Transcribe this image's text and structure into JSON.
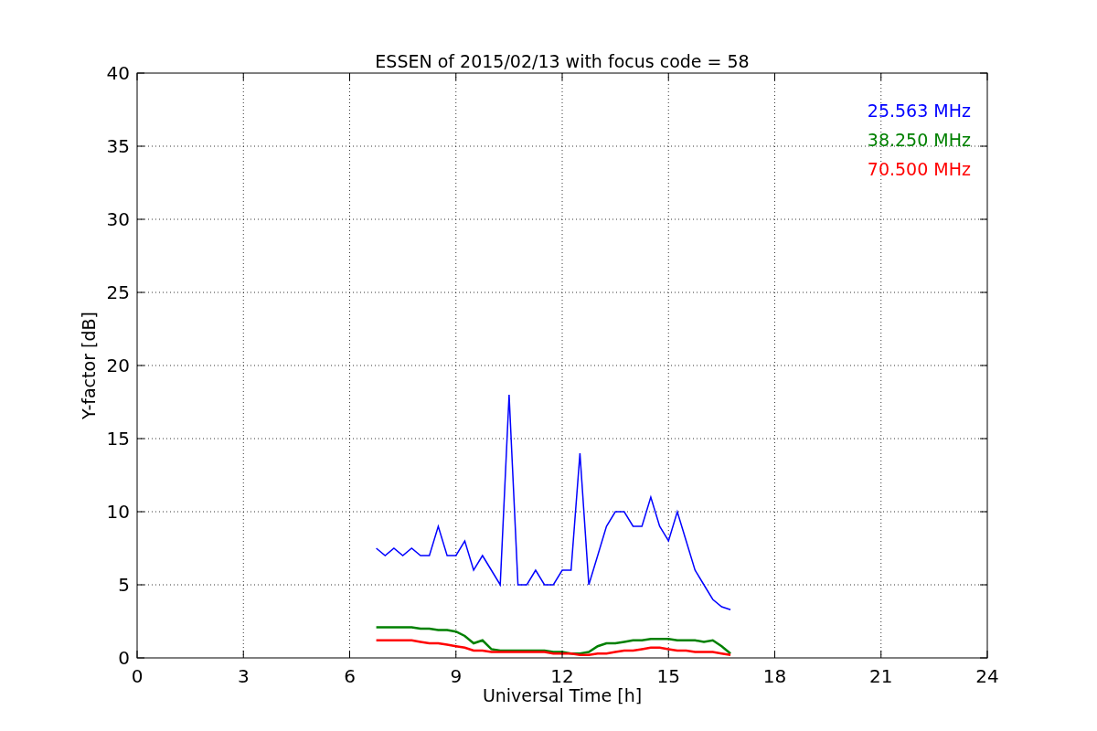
{
  "chart_data": {
    "type": "line",
    "title": "ESSEN of 2015/02/13 with focus code = 58",
    "xlabel": "Universal Time [h]",
    "ylabel": "Y-factor [dB]",
    "x": [
      6.75,
      7.0,
      7.25,
      7.5,
      7.75,
      8.0,
      8.25,
      8.5,
      8.75,
      9.0,
      9.25,
      9.5,
      9.75,
      10.0,
      10.25,
      10.5,
      10.75,
      11.0,
      11.25,
      11.5,
      11.75,
      12.0,
      12.25,
      12.5,
      12.75,
      13.0,
      13.25,
      13.5,
      13.75,
      14.0,
      14.25,
      14.5,
      14.75,
      15.0,
      15.25,
      15.5,
      15.75,
      16.0,
      16.25,
      16.5,
      16.75
    ],
    "series": [
      {
        "name": "25.563 MHz",
        "color": "#0000ff",
        "values": [
          7.5,
          7,
          7.5,
          7,
          7.5,
          7,
          7,
          9,
          7,
          7,
          8,
          6,
          7,
          6,
          5,
          18,
          5,
          5,
          6,
          5,
          5,
          6,
          6,
          14,
          5,
          7,
          9,
          10,
          10,
          9,
          9,
          11,
          9,
          8,
          10,
          8,
          6,
          5,
          4,
          3.5,
          3.3
        ]
      },
      {
        "name": "38.250 MHz",
        "color": "#008000",
        "values": [
          2.1,
          2.1,
          2.1,
          2.1,
          2.1,
          2.0,
          2.0,
          1.9,
          1.9,
          1.8,
          1.5,
          1.0,
          1.2,
          0.6,
          0.5,
          0.5,
          0.5,
          0.5,
          0.5,
          0.5,
          0.4,
          0.4,
          0.3,
          0.3,
          0.4,
          0.8,
          1.0,
          1.0,
          1.1,
          1.2,
          1.2,
          1.3,
          1.3,
          1.3,
          1.2,
          1.2,
          1.2,
          1.1,
          1.2,
          0.8,
          0.3
        ]
      },
      {
        "name": "70.500 MHz",
        "color": "#ff0000",
        "values": [
          1.2,
          1.2,
          1.2,
          1.2,
          1.2,
          1.1,
          1.0,
          1.0,
          0.9,
          0.8,
          0.7,
          0.5,
          0.5,
          0.4,
          0.4,
          0.4,
          0.4,
          0.4,
          0.4,
          0.4,
          0.3,
          0.3,
          0.3,
          0.2,
          0.2,
          0.3,
          0.3,
          0.4,
          0.5,
          0.5,
          0.6,
          0.7,
          0.7,
          0.6,
          0.5,
          0.5,
          0.4,
          0.4,
          0.4,
          0.3,
          0.2
        ]
      }
    ],
    "xlim": [
      0,
      24
    ],
    "ylim": [
      0,
      40
    ],
    "xticks": [
      0,
      3,
      6,
      9,
      12,
      15,
      18,
      21,
      24
    ],
    "yticks": [
      0,
      5,
      10,
      15,
      20,
      25,
      30,
      35,
      40
    ],
    "grid": true
  }
}
